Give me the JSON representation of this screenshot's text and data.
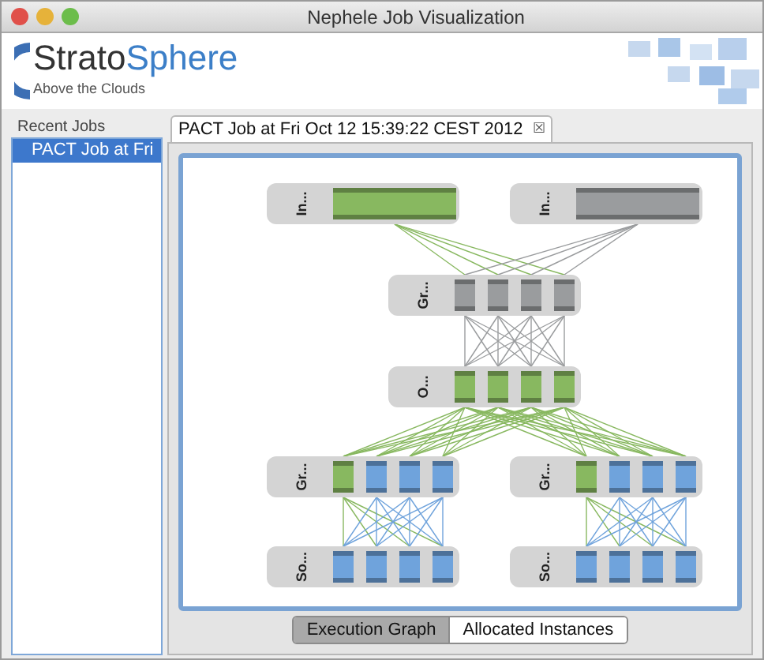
{
  "window": {
    "title": "Nephele Job Visualization"
  },
  "header": {
    "logo_main": "Strato",
    "logo_accent": "Sphere",
    "tagline": "Above the Clouds"
  },
  "sidebar": {
    "title": "Recent Jobs",
    "items": [
      {
        "label": "PACT Job at Fri",
        "selected": true
      }
    ]
  },
  "tabs": [
    {
      "label": "PACT Job at Fri Oct 12 15:39:22 CEST 2012",
      "close": "☒",
      "selected": true
    }
  ],
  "graph": {
    "layers": [
      [
        {
          "label": "In...",
          "subtasks": [
            {
              "color": "#88b860"
            }
          ]
        },
        {
          "label": "In...",
          "subtasks": [
            {
              "color": "#9a9c9e"
            }
          ]
        }
      ],
      [
        {
          "label": "Gr...",
          "subtasks": [
            {
              "color": "#9a9c9e"
            },
            {
              "color": "#9a9c9e"
            },
            {
              "color": "#9a9c9e"
            },
            {
              "color": "#9a9c9e"
            }
          ]
        }
      ],
      [
        {
          "label": "O...",
          "subtasks": [
            {
              "color": "#88b860"
            },
            {
              "color": "#88b860"
            },
            {
              "color": "#88b860"
            },
            {
              "color": "#88b860"
            }
          ]
        }
      ],
      [
        {
          "label": "Gr...",
          "subtasks": [
            {
              "color": "#88b860"
            },
            {
              "color": "#6fa3dc"
            },
            {
              "color": "#6fa3dc"
            },
            {
              "color": "#6fa3dc"
            }
          ]
        },
        {
          "label": "Gr...",
          "subtasks": [
            {
              "color": "#88b860"
            },
            {
              "color": "#6fa3dc"
            },
            {
              "color": "#6fa3dc"
            },
            {
              "color": "#6fa3dc"
            }
          ]
        }
      ],
      [
        {
          "label": "So...",
          "subtasks": [
            {
              "color": "#6fa3dc"
            },
            {
              "color": "#6fa3dc"
            },
            {
              "color": "#6fa3dc"
            },
            {
              "color": "#6fa3dc"
            }
          ]
        },
        {
          "label": "So...",
          "subtasks": [
            {
              "color": "#6fa3dc"
            },
            {
              "color": "#6fa3dc"
            },
            {
              "color": "#6fa3dc"
            },
            {
              "color": "#6fa3dc"
            }
          ]
        }
      ]
    ]
  },
  "view_switch": [
    {
      "label": "Execution Graph",
      "selected": true
    },
    {
      "label": "Allocated Instances",
      "selected": false
    }
  ]
}
